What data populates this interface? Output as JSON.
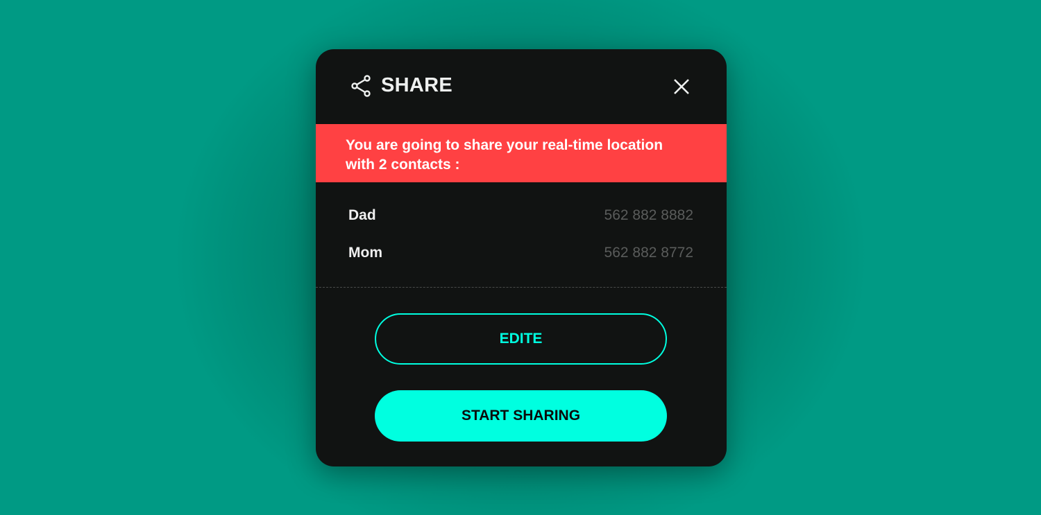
{
  "dialog": {
    "title": "SHARE",
    "icons": {
      "title": "share-icon",
      "close": "close-icon"
    },
    "warning": "You are going to share your real-time location with 2 contacts :",
    "contacts": [
      {
        "name": "Dad",
        "phone": "562 882 8882"
      },
      {
        "name": "Mom",
        "phone": "562 882 8772"
      }
    ],
    "edit_label": "EDITE",
    "start_label": "START SHARING",
    "colors": {
      "accent": "#00ffe0",
      "warning": "#ff4143",
      "background": "#111312"
    }
  }
}
